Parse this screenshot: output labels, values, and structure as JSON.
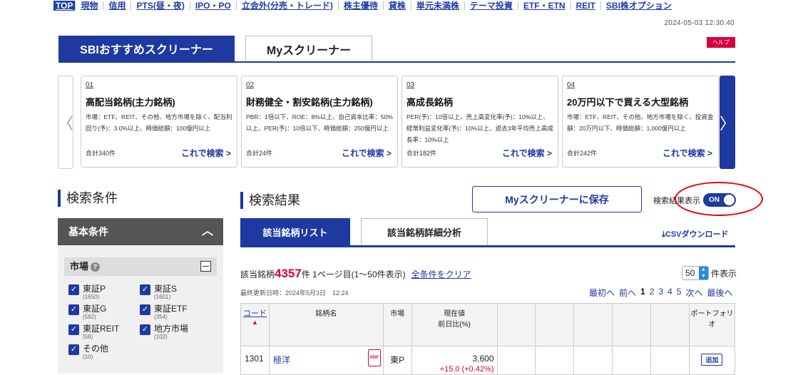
{
  "nav": {
    "items": [
      "TOP",
      "現物",
      "信用",
      "PTS(昼・夜)",
      "IPO・PO",
      "立会外(分売・トレード)",
      "株主優待",
      "貸株",
      "単元未満株",
      "テーマ投資",
      "ETF・ETN",
      "REIT",
      "SBI株オプション"
    ]
  },
  "timestamp": "2024-05-03 12:30:40",
  "tabs": {
    "sbi": "SBIおすすめスクリーナー",
    "my": "Myスクリーナー"
  },
  "help_label": "ヘルプ",
  "carousel": {
    "cards": [
      {
        "num": "01",
        "title": "高配当銘柄(主力銘柄)",
        "desc": "市場：ETF、REIT、その他、地方市場を除く、配当利回り(予)：3.0%以上、時価総額：100億円以上",
        "count": "合計340件",
        "search": "これで検索 >"
      },
      {
        "num": "02",
        "title": "財務健全・割安銘柄(主力銘柄)",
        "desc": "PBR：1倍以下、ROE：8%以上、自己資本比率：50%以上、PER(予)：10倍以下、時価総額：250億円以上",
        "count": "合計24件",
        "search": "これで検索 >"
      },
      {
        "num": "03",
        "title": "高成長銘柄",
        "desc": "PER(予)：10倍以上、売上高変化率(予)：10%以上、経常利益変化率(予)：10%以上、過去3年平均売上高成長率：10%以上",
        "count": "合計182件",
        "search": "これで検索 >"
      },
      {
        "num": "04",
        "title": "20万円以下で買える大型銘柄",
        "desc": "市場：ETF、REIT、その他、地方市場を除く、投資金額：20万円以下、時価総額：1,000億円以上",
        "count": "合計242件",
        "search": "これで検索 >"
      }
    ]
  },
  "left": {
    "title": "検索条件",
    "basic": "基本条件",
    "market": "市場",
    "checks": [
      {
        "label": "東証P",
        "count": "(1650)"
      },
      {
        "label": "東証S",
        "count": "(1601)"
      },
      {
        "label": "東証G",
        "count": "(582)"
      },
      {
        "label": "東証ETF",
        "count": "(354)"
      },
      {
        "label": "東証REIT",
        "count": "(58)"
      },
      {
        "label": "地方市場",
        "count": "(102)"
      },
      {
        "label": "その他",
        "count": "(10)"
      }
    ]
  },
  "results": {
    "title": "検索結果",
    "save": "Myスクリーナーに保存",
    "toggle_label": "検索結果表示",
    "toggle_state": "ON",
    "tab_list": "該当銘柄リスト",
    "tab_detail": "該当銘柄詳細分析",
    "csv": "CSVダウンロード",
    "hit_prefix": "該当銘柄",
    "hit_count": "4357",
    "hit_suffix": "件 1ページ目(1〜50件表示)",
    "clear": "全条件をクリア",
    "perpage_value": "50",
    "perpage_unit": "件表示",
    "updated": "最終更新日時：2024年5月3日　12:24",
    "pager": {
      "first": "最初へ",
      "prev": "前へ",
      "pages": [
        "1",
        "2",
        "3",
        "4",
        "5"
      ],
      "next": "次へ",
      "last": "最後へ"
    },
    "table": {
      "headers": {
        "code": "コード",
        "name": "銘柄名",
        "market": "市場",
        "price": "現在値",
        "change": "前日比(%)",
        "portfolio": "ポートフォリオ"
      },
      "rows": [
        {
          "code": "1301",
          "name": "極洋",
          "market": "東P",
          "price": "3,600",
          "change": "+15.0 (+0.42%)",
          "add": "追加"
        }
      ]
    }
  }
}
